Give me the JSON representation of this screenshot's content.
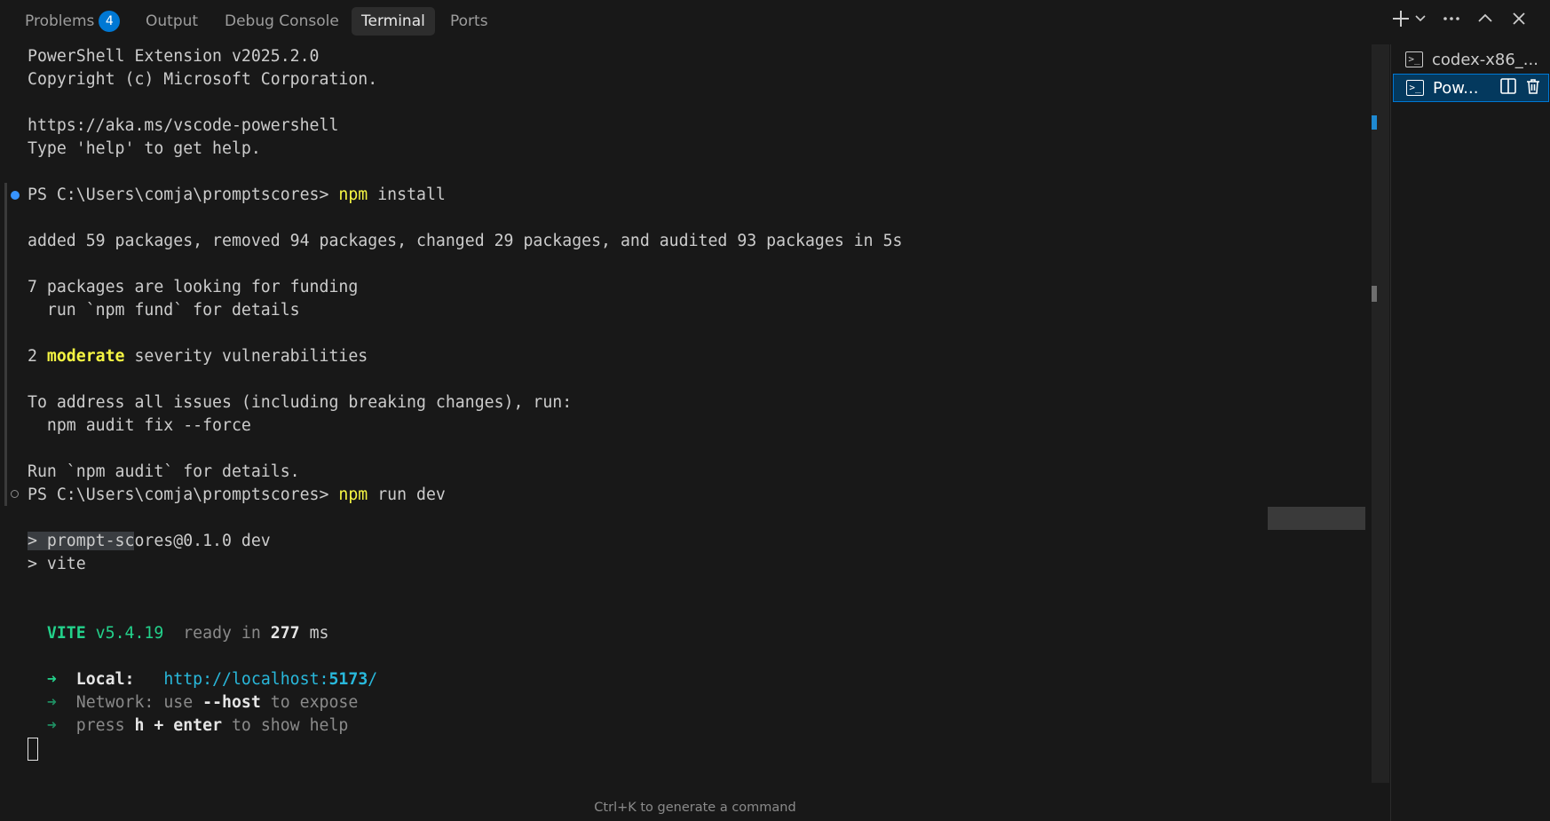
{
  "tabs": [
    {
      "label": "Problems",
      "badge": "4"
    },
    {
      "label": "Output"
    },
    {
      "label": "Debug Console"
    },
    {
      "label": "Terminal",
      "active": true
    },
    {
      "label": "Ports"
    }
  ],
  "toolbar": {
    "new_terminal_icon": "plus-icon",
    "dropdown_icon": "chevron-down-icon",
    "more_icon": "ellipsis-icon",
    "maximize_icon": "chevron-up-icon",
    "close_icon": "close-icon"
  },
  "terminal_lines": {
    "l1": "PowerShell Extension v2025.2.0",
    "l2": "Copyright (c) Microsoft Corporation.",
    "l3": "https://aka.ms/vscode-powershell",
    "l4": "Type 'help' to get help.",
    "prompt1": "PS C:\\Users\\comja\\promptscores> ",
    "cmd1_a": "npm",
    "cmd1_b": " install",
    "l6": "added 59 packages, removed 94 packages, changed 29 packages, and audited 93 packages in 5s",
    "l7": "7 packages are looking for funding",
    "l8": "  run `npm fund` for details",
    "l9_a": "2 ",
    "l9_b": "moderate",
    "l9_c": " severity vulnerabilities",
    "l10": "To address all issues (including breaking changes), run:",
    "l11": "  npm audit fix --force",
    "l12": "Run `npm audit` for details.",
    "prompt2": "PS C:\\Users\\comja\\promptscores> ",
    "cmd2_a": "npm",
    "cmd2_b": " run dev",
    "l13_sel": "> prompt-sc",
    "l13_rest": "ores@0.1.0 dev",
    "l14": "> vite",
    "vite_name": "VITE",
    "vite_ver": " v5.4.19",
    "vite_ready": "  ready in ",
    "vite_ms": "277",
    "vite_unit": " ms",
    "arrow": "➜",
    "local_label": "Local:",
    "local_url_a": "http://localhost:",
    "local_url_b": "5173",
    "local_url_c": "/",
    "network_label": "Network",
    "network_a": ": use ",
    "network_b": "--host",
    "network_c": " to expose",
    "press_a": "press ",
    "press_b": "h + enter",
    "press_c": " to show help"
  },
  "hint": "Ctrl+K to generate a command",
  "terminals": [
    {
      "label": "codex-x86_...",
      "icon": "terminal-icon"
    },
    {
      "label": "Pow...",
      "icon": "terminal-icon",
      "active": true
    }
  ],
  "colors": {
    "background": "#181818",
    "accent": "#0078d4",
    "yellow": "#f5f543",
    "green": "#23d18b",
    "cyan": "#29b8db"
  }
}
